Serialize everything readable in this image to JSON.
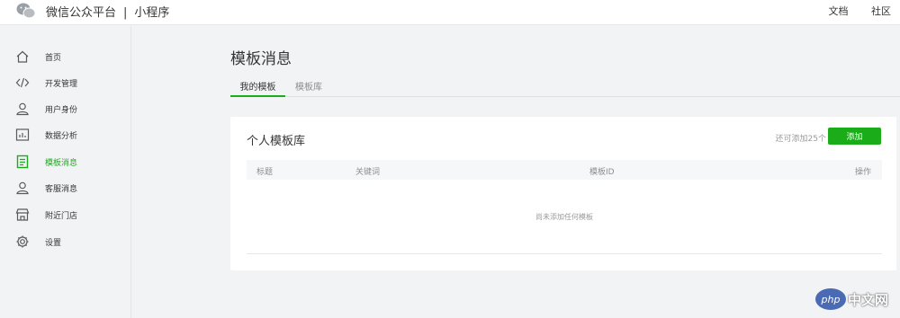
{
  "header": {
    "brand_main": "微信公众平台",
    "brand_sep": "|",
    "brand_sub": "小程序",
    "links": [
      "文档",
      "社区"
    ]
  },
  "sidebar": {
    "items": [
      {
        "label": "首页",
        "icon": "home-icon"
      },
      {
        "label": "开发管理",
        "icon": "code-icon"
      },
      {
        "label": "用户身份",
        "icon": "user-icon"
      },
      {
        "label": "数据分析",
        "icon": "chart-icon"
      },
      {
        "label": "模板消息",
        "icon": "document-icon",
        "active": true
      },
      {
        "label": "客服消息",
        "icon": "customer-service-icon"
      },
      {
        "label": "附近门店",
        "icon": "store-icon"
      },
      {
        "label": "设置",
        "icon": "gear-icon"
      }
    ]
  },
  "main": {
    "title": "模板消息",
    "tabs": [
      {
        "label": "我的模板",
        "active": true
      },
      {
        "label": "模板库",
        "active": false
      }
    ],
    "card": {
      "title": "个人模板库",
      "remaining": "还可添加25个",
      "add_label": "添加",
      "columns": [
        "标题",
        "关键词",
        "模板ID",
        "操作"
      ],
      "empty_text": "尚未添加任何模板"
    }
  },
  "watermark": {
    "badge": "php",
    "text": "中文网"
  },
  "colors": {
    "accent": "#1aad19",
    "background": "#f2f3f5",
    "card": "#ffffff",
    "watermark_blue": "#4a6bb3"
  }
}
